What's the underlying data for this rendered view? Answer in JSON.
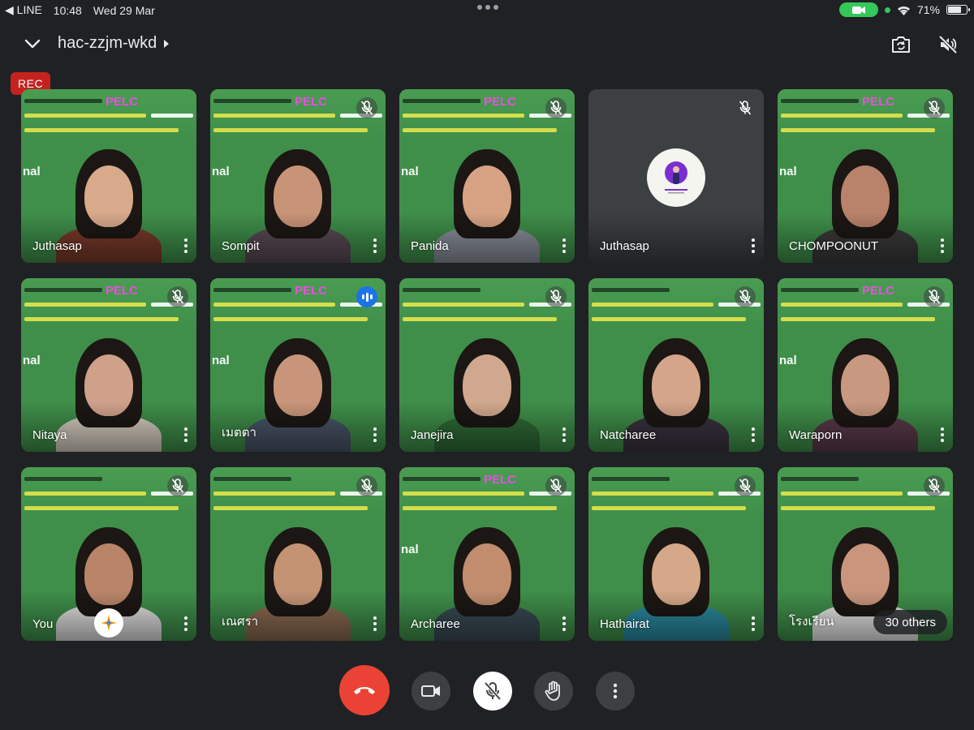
{
  "status_bar": {
    "back_app": "◀ LINE",
    "time": "10:48",
    "date": "Wed 29 Mar",
    "battery": "71%",
    "battery_level": 0.71
  },
  "header": {
    "meeting_code": "hac-zzjm-wkd",
    "rec_label": "REC"
  },
  "banner": {
    "pelc": "PELC",
    "nal": "nal"
  },
  "participants": [
    {
      "name": "Juthasap",
      "muted": false,
      "speaking": false
    },
    {
      "name": "Sompit",
      "muted": true,
      "speaking": false
    },
    {
      "name": "Panida",
      "muted": true,
      "speaking": false
    },
    {
      "name": "Juthasap",
      "muted": true,
      "speaking": false,
      "video_off": true
    },
    {
      "name": "CHOMPOONUT",
      "muted": true,
      "speaking": false
    },
    {
      "name": "Nitaya",
      "muted": true,
      "speaking": false
    },
    {
      "name": "เมตตา",
      "muted": false,
      "speaking": true
    },
    {
      "name": "Janejira",
      "muted": true,
      "speaking": false
    },
    {
      "name": "Natcharee",
      "muted": true,
      "speaking": false
    },
    {
      "name": "Waraporn",
      "muted": true,
      "speaking": false
    },
    {
      "name": "You",
      "muted": true,
      "speaking": false
    },
    {
      "name": "เณศรา",
      "muted": true,
      "speaking": false
    },
    {
      "name": "Archaree",
      "muted": true,
      "speaking": false
    },
    {
      "name": "Hathairat",
      "muted": true,
      "speaking": false
    },
    {
      "name": "โรงเรียน",
      "muted": true,
      "speaking": false
    }
  ],
  "others_count": "30 others",
  "colors": {
    "background": "#202124",
    "end_call": "#ea4335",
    "rec": "#c5221f",
    "speaking": "#1a73e8",
    "green_screen": "#3f8f4a"
  }
}
